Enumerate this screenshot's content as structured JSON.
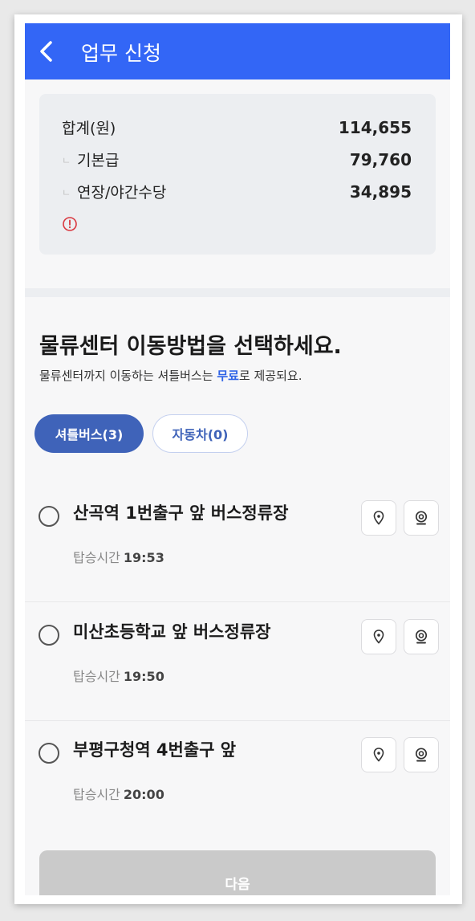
{
  "header": {
    "title": "업무 신청"
  },
  "summary": {
    "total_label": "합계(원)",
    "total_value": "114,655",
    "base_label": "기본급",
    "base_value": "79,760",
    "extra_label": "연장/야간수당",
    "extra_value": "34,895"
  },
  "section": {
    "title": "물류센터 이동방법을 선택하세요.",
    "desc_before": "물류센터까지 이동하는 셔틀버스는 ",
    "desc_highlight": "무료",
    "desc_after": "로 제공되요."
  },
  "tabs": {
    "bus": "셔틀버스(3)",
    "car": "자동차(0)"
  },
  "stops": [
    {
      "name": "산곡역 1번출구 앞 버스정류장",
      "time_label": "탑승시간",
      "time": "19:53"
    },
    {
      "name": "미산초등학교 앞 버스정류장",
      "time_label": "탑승시간",
      "time": "19:50"
    },
    {
      "name": "부평구청역 4번출구 앞",
      "time_label": "탑승시간",
      "time": "20:00"
    }
  ],
  "next_button": "다음",
  "colors": {
    "header": "#3366f6",
    "tab_active": "#3f63b9",
    "highlight": "#2f63e6",
    "warning": "#d9363e"
  },
  "icons": [
    "chevron-left-icon",
    "warning-circle-icon",
    "map-pin-icon",
    "camera-icon"
  ]
}
